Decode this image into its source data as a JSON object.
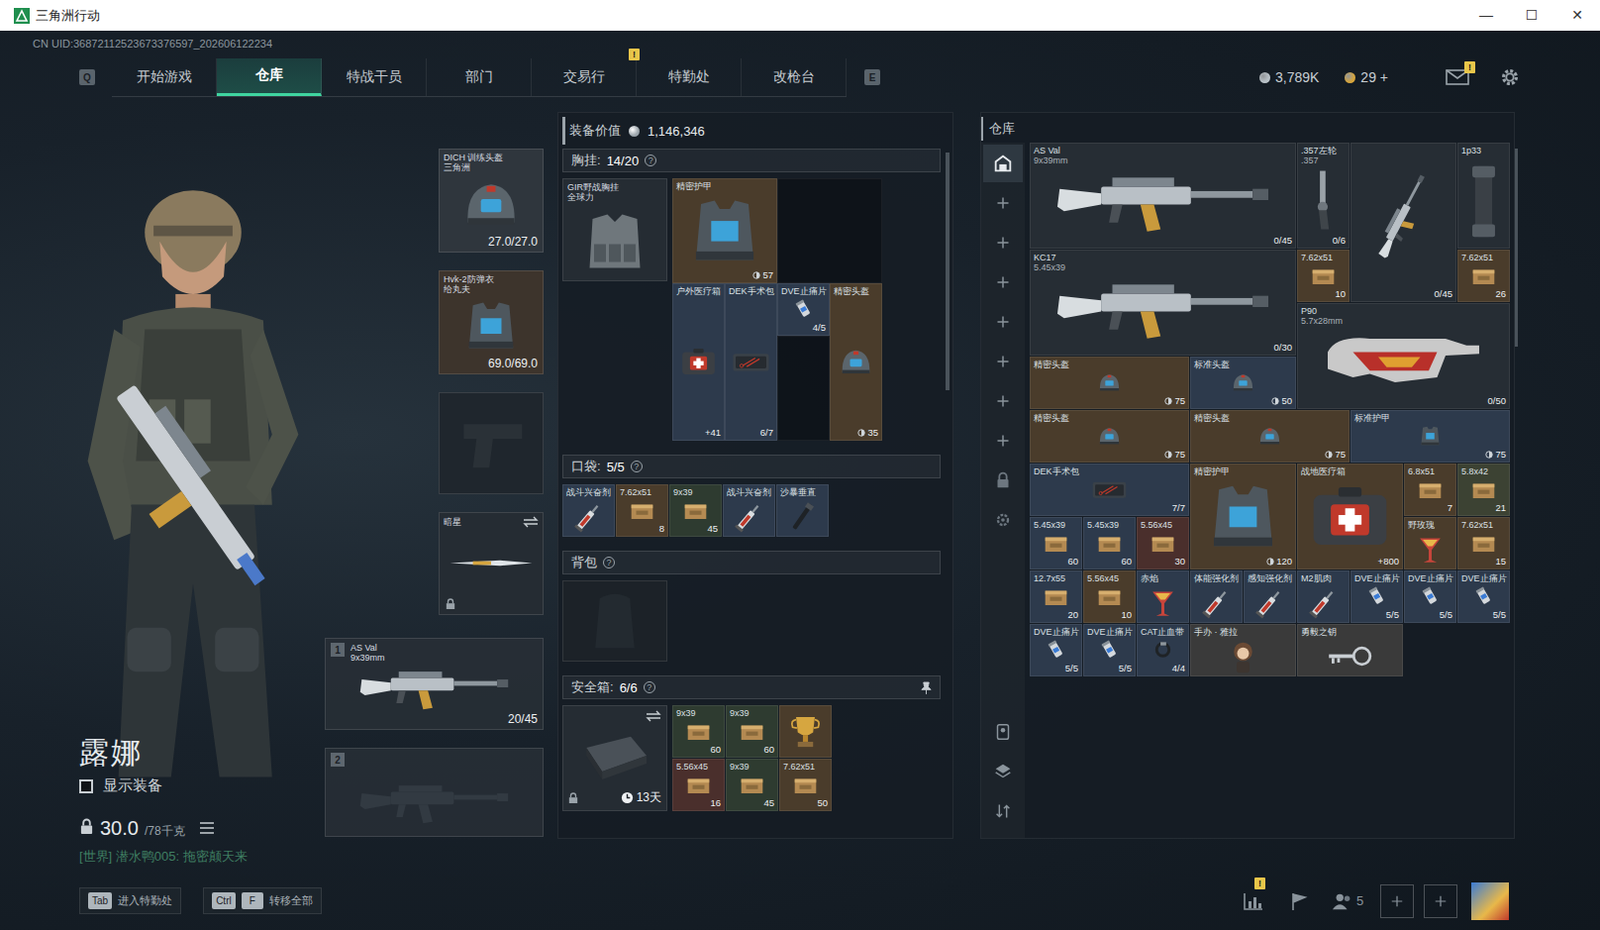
{
  "window": {
    "title": "三角洲行动",
    "controls": [
      "—",
      "☐",
      "✕"
    ]
  },
  "uid": "CN UID:36872112523673376597_202606122234",
  "nav": {
    "keys": [
      "Q",
      "E"
    ],
    "tabs": [
      {
        "label": "开始游戏",
        "selected": false
      },
      {
        "label": "仓库",
        "selected": true
      },
      {
        "label": "特战干员",
        "selected": false
      },
      {
        "label": "部门",
        "selected": false
      },
      {
        "label": "交易行",
        "selected": false
      },
      {
        "label": "特勤处",
        "selected": false,
        "badge": "!"
      },
      {
        "label": "改枪台",
        "selected": false
      }
    ],
    "currencies": [
      {
        "value": "3,789K",
        "color": "#b9c2c8"
      },
      {
        "value": "29 +",
        "color": "#d7a53b"
      }
    ],
    "mail_badge": "!"
  },
  "operator": {
    "name": "露娜",
    "show_equipment": {
      "label": "显示装备",
      "checked": false
    },
    "weight": "30.0",
    "weight_max": "/78千克",
    "chat": "[世界] 潜水鸭005: 拖密颠天来"
  },
  "equipment": [
    {
      "kind": "helmet",
      "name": "DICH 训练头盔",
      "sub": "三角洲",
      "value": "27.0/27.0",
      "color": "#2f363d"
    },
    {
      "kind": "armor",
      "name": "Hvk-2防弹衣",
      "sub": "给丸夫",
      "value": "69.0/69.0",
      "color": "#3d342c"
    },
    {
      "kind": "holster",
      "color": "#1f262d"
    },
    {
      "kind": "melee",
      "name": "暗星",
      "color": "#252c33"
    }
  ],
  "weapons": [
    {
      "badge": "1",
      "name": "AS Val",
      "sub": "9x39mm",
      "ammo": "20/45",
      "kind": "rifle"
    },
    {
      "badge": "2",
      "kind": "empty"
    }
  ],
  "loadout": {
    "value_label": "装备价值",
    "value": "1,146,346",
    "rig": {
      "label": "胸挂:",
      "count": "14/20",
      "help": "?",
      "slot": {
        "name": "GIR野战胸挂",
        "sub": "全球力"
      },
      "items": [
        {
          "name": "精密护甲",
          "value": "57",
          "kind": "armor",
          "color": "#4a3c2b"
        },
        {
          "name": "户外医疗箱",
          "value": "+41",
          "kind": "medkit",
          "color": "#2d3a4c"
        },
        {
          "name": "DEK手术包",
          "value": "6/7",
          "kind": "surgery",
          "color": "#2d3a4c"
        },
        {
          "name": "DVE止痛片",
          "value": "4/5",
          "kind": "pill",
          "color": "#2d3a4c"
        },
        {
          "name": "精密头盔",
          "value": "35",
          "kind": "helmet",
          "color": "#4a3c2b"
        }
      ]
    },
    "pockets": {
      "label": "口袋:",
      "count": "5/5",
      "help": "?",
      "items": [
        {
          "name": "战斗兴奋剂",
          "kind": "syringe",
          "color": "#2d3a4c"
        },
        {
          "name": "7.62x51",
          "value": "8",
          "kind": "ammo",
          "color": "#4a3c2b"
        },
        {
          "name": "9x39",
          "value": "45",
          "kind": "ammo",
          "color": "#2e3b30"
        },
        {
          "name": "战斗兴奋剂",
          "kind": "syringe",
          "color": "#2d3a4c"
        },
        {
          "name": "沙暴垂直",
          "kind": "grip",
          "color": "#2d3a4c"
        }
      ]
    },
    "backpack": {
      "label": "背包",
      "help": "?"
    },
    "safe": {
      "label": "安全箱:",
      "count": "6/6",
      "help": "?",
      "days": "13天",
      "items": [
        {
          "name": "9x39",
          "value": "60",
          "kind": "ammo",
          "color": "#2e3b30"
        },
        {
          "name": "9x39",
          "value": "60",
          "kind": "ammo",
          "color": "#2e3b30"
        },
        {
          "kind": "trophy",
          "color": "#4a3c2b"
        },
        {
          "name": "5.56x45",
          "value": "16",
          "kind": "ammo",
          "color": "#4a2f2c"
        },
        {
          "name": "9x39",
          "value": "45",
          "kind": "ammo",
          "color": "#2e3b30"
        },
        {
          "name": "7.62x51",
          "value": "50",
          "kind": "ammo",
          "color": "#4a3c2b"
        }
      ]
    }
  },
  "warehouse": {
    "title": "仓库",
    "sidebar": [
      {
        "kind": "warehouse",
        "selected": true
      },
      {
        "kind": "add",
        "selected": false
      },
      {
        "kind": "add",
        "selected": false
      },
      {
        "kind": "add",
        "selected": false
      },
      {
        "kind": "add",
        "selected": false
      },
      {
        "kind": "add",
        "selected": false
      },
      {
        "kind": "add",
        "selected": false
      },
      {
        "kind": "add",
        "selected": false
      },
      {
        "kind": "lock",
        "selected": false
      },
      {
        "kind": "settings",
        "selected": false
      },
      {
        "kind": "person",
        "selected": false
      },
      {
        "kind": "layers",
        "selected": false
      },
      {
        "kind": "sort",
        "selected": false
      }
    ],
    "items": [
      {
        "name": "AS Val",
        "sub": "9x39mm",
        "value": "0/45",
        "kind": "rifle",
        "color": "#262d34"
      },
      {
        "name": ".357左轮",
        "sub": ".357",
        "value": "0/6",
        "kind": "pistol",
        "color": "#262d34"
      },
      {
        "value": "0/45",
        "kind": "vrifle",
        "color": "#262d34"
      },
      {
        "name": "1p33",
        "kind": "scope",
        "color": "#262d34"
      },
      {
        "name": "KC17",
        "sub": "5.45x39",
        "value": "0/30",
        "kind": "rifle",
        "color": "#262d34"
      },
      {
        "name": "7.62x51",
        "value": "10",
        "kind": "ammo",
        "color": "#4a3c2b"
      },
      {
        "name": "7.62x51",
        "value": "26",
        "kind": "ammo",
        "color": "#4a3c2b"
      },
      {
        "name": "P90",
        "sub": "5.7x28mm",
        "value": "0/50",
        "kind": "smg",
        "color": "#262d34"
      },
      {
        "name": "精密头盔",
        "value": "75",
        "kind": "helmet",
        "color": "#4a3c2b"
      },
      {
        "name": "标准头盔",
        "value": "50",
        "kind": "helmet",
        "color": "#2d3a4c"
      },
      {
        "name": "精密头盔",
        "value": "75",
        "kind": "helmet",
        "color": "#4a3c2b"
      },
      {
        "name": "精密头盔",
        "value": "75",
        "kind": "helmet",
        "color": "#4a3c2b"
      },
      {
        "name": "标准护甲",
        "value": "75",
        "kind": "armor",
        "color": "#2d3a4c"
      },
      {
        "name": "DEK手术包",
        "value": "7/7",
        "kind": "surgery",
        "color": "#2d3a4c"
      },
      {
        "name": "精密护甲",
        "value": "120",
        "kind": "armor",
        "color": "#4a3c2b"
      },
      {
        "name": "战地医疗箱",
        "value": "+800",
        "kind": "medkit",
        "color": "#4a3c2b"
      },
      {
        "name": "6.8x51",
        "value": "7",
        "kind": "ammo",
        "color": "#4a3c2b"
      },
      {
        "name": "5.8x42",
        "value": "21",
        "kind": "ammo",
        "color": "#3c4233"
      },
      {
        "name": "5.45x39",
        "value": "60",
        "kind": "ammo",
        "color": "#2d3a4c"
      },
      {
        "name": "5.45x39",
        "value": "60",
        "kind": "ammo",
        "color": "#2d3a4c"
      },
      {
        "name": "5.56x45",
        "value": "30",
        "kind": "ammo",
        "color": "#4a2f2c"
      },
      {
        "name": "野玫瑰",
        "kind": "drink",
        "color": "#4a3c2b"
      },
      {
        "name": "7.62x51",
        "value": "15",
        "kind": "ammo",
        "color": "#4a3c2b"
      },
      {
        "name": "12.7x55",
        "value": "20",
        "kind": "ammo",
        "color": "#2d3a4c"
      },
      {
        "name": "5.56x45",
        "value": "10",
        "kind": "ammo",
        "color": "#4a3c2b"
      },
      {
        "name": "赤焰",
        "kind": "drink",
        "color": "#2d3a4c"
      },
      {
        "name": "体能强化剂",
        "kind": "syringe",
        "color": "#2d3a4c"
      },
      {
        "name": "感知强化剂",
        "kind": "syringe",
        "color": "#2d3a4c"
      },
      {
        "name": "M2肌肉",
        "kind": "syringe",
        "color": "#2d3a4c"
      },
      {
        "name": "DVE止痛片",
        "value": "5/5",
        "kind": "pill",
        "color": "#2d3a4c"
      },
      {
        "name": "DVE止痛片",
        "value": "5/5",
        "kind": "pill",
        "color": "#2d3a4c"
      },
      {
        "name": "DVE止痛片",
        "value": "5/5",
        "kind": "pill",
        "color": "#2d3a4c"
      },
      {
        "name": "DVE止痛片",
        "value": "5/5",
        "kind": "pill",
        "color": "#2d3a4c"
      },
      {
        "name": "DVE止痛片",
        "value": "5/5",
        "kind": "pill",
        "color": "#2d3a4c"
      },
      {
        "name": "CAT止血带",
        "value": "4/4",
        "kind": "tourniquet",
        "color": "#2d3a4c"
      },
      {
        "name": "手办 · 雅拉",
        "kind": "figure",
        "color": "#3a3a3a"
      },
      {
        "name": "勇毅之钥",
        "kind": "key",
        "color": "#3a3a3a"
      }
    ]
  },
  "bottom": {
    "hints": [
      {
        "keys": [
          "Tab"
        ],
        "label": "进入特勤处"
      },
      {
        "keys": [
          "Ctrl",
          "F"
        ],
        "label": "转移全部"
      }
    ],
    "chart_badge": "!",
    "team_count": "5"
  }
}
